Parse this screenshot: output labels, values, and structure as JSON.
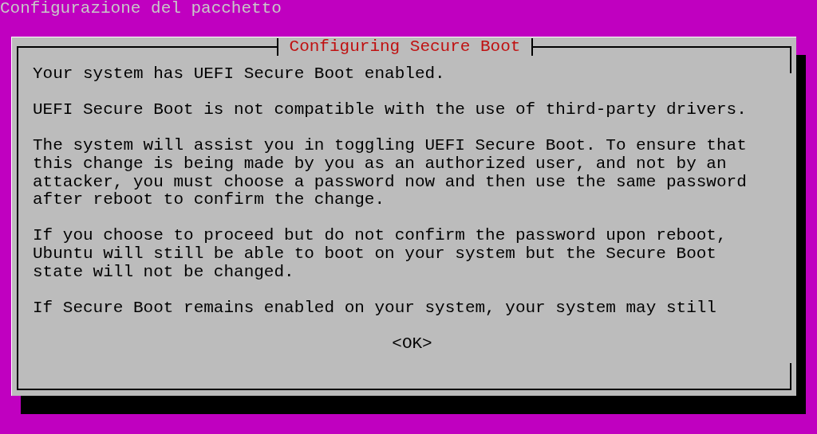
{
  "screen_title": "Configurazione del pacchetto",
  "dialog": {
    "title": "Configuring Secure Boot",
    "paragraphs": [
      [
        "Your system has UEFI Secure Boot enabled."
      ],
      [
        "UEFI Secure Boot is not compatible with the use of third-party drivers."
      ],
      [
        "The system will assist you in toggling UEFI Secure Boot. To ensure that",
        "this change is being made by you as an authorized user, and not by an",
        "attacker, you must choose a password now and then use the same password",
        "after reboot to confirm the change."
      ],
      [
        "If you choose to proceed but do not confirm the password upon reboot,",
        "Ubuntu will still be able to boot on your system but the Secure Boot",
        "state will not be changed."
      ],
      [
        "If Secure Boot remains enabled on your system, your system may still"
      ]
    ],
    "button": "<OK>"
  }
}
